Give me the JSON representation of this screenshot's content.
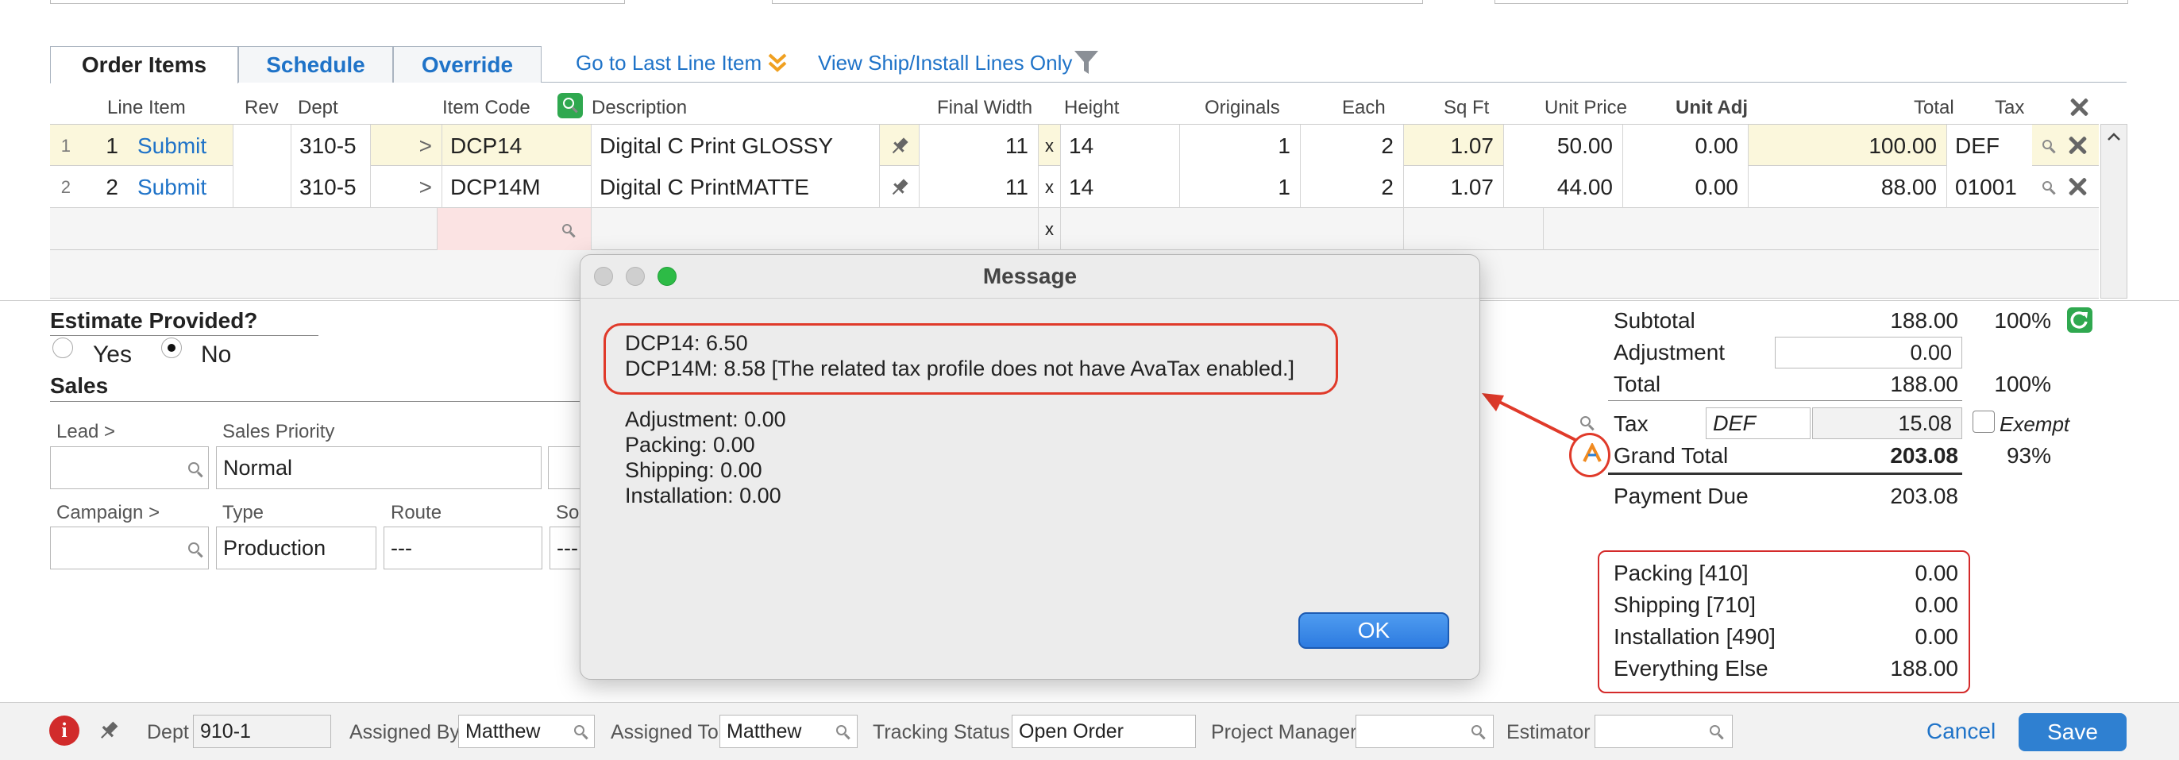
{
  "tabs": [
    {
      "label": "Order Items",
      "active": true
    },
    {
      "label": "Schedule",
      "active": false
    },
    {
      "label": "Override",
      "active": false
    }
  ],
  "toolbar": {
    "go_last": "Go to Last Line Item",
    "view_ship": "View Ship/Install Lines Only"
  },
  "columns": {
    "line_item": "Line Item",
    "rev": "Rev",
    "dept": "Dept",
    "item_code": "Item Code",
    "description": "Description",
    "final_width": "Final Width",
    "height": "Height",
    "originals": "Originals",
    "each": "Each",
    "sqft": "Sq Ft",
    "unit_price": "Unit Price",
    "unit_adj": "Unit Adj",
    "total": "Total",
    "tax": "Tax"
  },
  "rows": [
    {
      "idx": "1",
      "line": "1",
      "action": "Submit",
      "dept": "310-5",
      "arrow": ">",
      "code": "DCP14",
      "desc": "Digital C Print GLOSSY",
      "width": "11",
      "x": "x",
      "height": "14",
      "originals": "1",
      "each": "2",
      "sqft": "1.07",
      "unit_price": "50.00",
      "unit_adj": "0.00",
      "total": "100.00",
      "tax": "DEF"
    },
    {
      "idx": "2",
      "line": "2",
      "action": "Submit",
      "dept": "310-5",
      "arrow": ">",
      "code": "DCP14M",
      "desc": "Digital C PrintMATTE",
      "width": "11",
      "x": "x",
      "height": "14",
      "originals": "1",
      "each": "2",
      "sqft": "1.07",
      "unit_price": "44.00",
      "unit_adj": "0.00",
      "total": "88.00",
      "tax": "01001"
    }
  ],
  "blank_row": {
    "x": "x"
  },
  "estimate": {
    "title": "Estimate Provided?",
    "yes": "Yes",
    "no": "No",
    "selected": "No"
  },
  "sales": {
    "title": "Sales",
    "lead_label": "Lead >",
    "priority_label": "Sales Priority",
    "priority_value": "Normal",
    "campaign_label": "Campaign >",
    "type_label": "Type",
    "type_value": "Production",
    "route_label": "Route",
    "route_value": "---",
    "so_label": "So",
    "so_value": "---"
  },
  "dialog": {
    "title": "Message",
    "line1": "DCP14: 6.50",
    "line2": "DCP14M: 8.58 [The related tax profile does not have AvaTax enabled.]",
    "line3": "Adjustment: 0.00",
    "line4": "Packing: 0.00",
    "line5": "Shipping: 0.00",
    "line6": "Installation: 0.00",
    "ok": "OK"
  },
  "summary": {
    "subtotal_label": "Subtotal",
    "subtotal": "188.00",
    "subtotal_pct": "100%",
    "adjustment_label": "Adjustment",
    "adjustment": "0.00",
    "total_label": "Total",
    "total": "188.00",
    "total_pct": "100%",
    "tax_label": "Tax",
    "tax_code": "DEF",
    "tax": "15.08",
    "exempt_label": "Exempt",
    "grand_label": "Grand Total",
    "grand": "203.08",
    "grand_pct": "93%",
    "payment_label": "Payment Due",
    "payment": "203.08"
  },
  "breakdown": [
    {
      "label": "Packing [410]",
      "value": "0.00"
    },
    {
      "label": "Shipping [710]",
      "value": "0.00"
    },
    {
      "label": "Installation [490]",
      "value": "0.00"
    },
    {
      "label": "Everything Else",
      "value": "188.00"
    }
  ],
  "footer": {
    "dept_label": "Dept",
    "dept_value": "910-1",
    "assigned_by_label": "Assigned By",
    "assigned_by": "Matthew",
    "assigned_to_label": "Assigned To",
    "assigned_to": "Matthew",
    "tracking_label": "Tracking Status",
    "tracking_value": "Open Order",
    "pm_label": "Project Manager",
    "estimator_label": "Estimator",
    "cancel": "Cancel",
    "save": "Save"
  },
  "colors": {
    "accent": "#1f73c8",
    "annotation": "#e03a2a",
    "save": "#2f80d1",
    "green": "#2fa84f"
  }
}
